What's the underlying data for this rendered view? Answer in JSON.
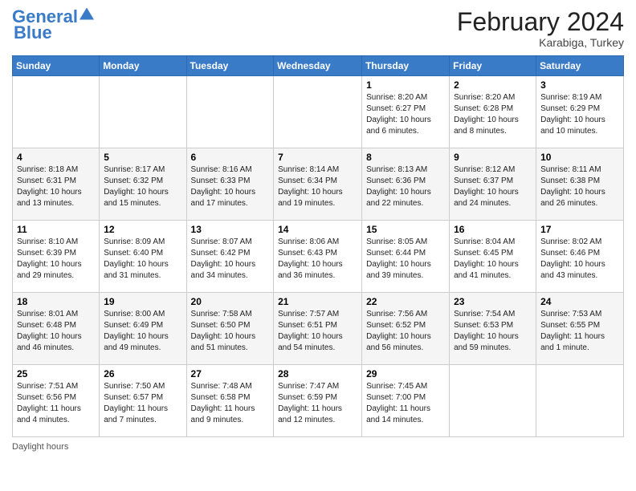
{
  "header": {
    "logo_line1": "General",
    "logo_line2": "Blue",
    "month_title": "February 2024",
    "location": "Karabiga, Turkey"
  },
  "footer": {
    "note": "Daylight hours"
  },
  "days_of_week": [
    "Sunday",
    "Monday",
    "Tuesday",
    "Wednesday",
    "Thursday",
    "Friday",
    "Saturday"
  ],
  "weeks": [
    [
      {
        "day": "",
        "info": ""
      },
      {
        "day": "",
        "info": ""
      },
      {
        "day": "",
        "info": ""
      },
      {
        "day": "",
        "info": ""
      },
      {
        "day": "1",
        "info": "Sunrise: 8:20 AM\nSunset: 6:27 PM\nDaylight: 10 hours\nand 6 minutes."
      },
      {
        "day": "2",
        "info": "Sunrise: 8:20 AM\nSunset: 6:28 PM\nDaylight: 10 hours\nand 8 minutes."
      },
      {
        "day": "3",
        "info": "Sunrise: 8:19 AM\nSunset: 6:29 PM\nDaylight: 10 hours\nand 10 minutes."
      }
    ],
    [
      {
        "day": "4",
        "info": "Sunrise: 8:18 AM\nSunset: 6:31 PM\nDaylight: 10 hours\nand 13 minutes."
      },
      {
        "day": "5",
        "info": "Sunrise: 8:17 AM\nSunset: 6:32 PM\nDaylight: 10 hours\nand 15 minutes."
      },
      {
        "day": "6",
        "info": "Sunrise: 8:16 AM\nSunset: 6:33 PM\nDaylight: 10 hours\nand 17 minutes."
      },
      {
        "day": "7",
        "info": "Sunrise: 8:14 AM\nSunset: 6:34 PM\nDaylight: 10 hours\nand 19 minutes."
      },
      {
        "day": "8",
        "info": "Sunrise: 8:13 AM\nSunset: 6:36 PM\nDaylight: 10 hours\nand 22 minutes."
      },
      {
        "day": "9",
        "info": "Sunrise: 8:12 AM\nSunset: 6:37 PM\nDaylight: 10 hours\nand 24 minutes."
      },
      {
        "day": "10",
        "info": "Sunrise: 8:11 AM\nSunset: 6:38 PM\nDaylight: 10 hours\nand 26 minutes."
      }
    ],
    [
      {
        "day": "11",
        "info": "Sunrise: 8:10 AM\nSunset: 6:39 PM\nDaylight: 10 hours\nand 29 minutes."
      },
      {
        "day": "12",
        "info": "Sunrise: 8:09 AM\nSunset: 6:40 PM\nDaylight: 10 hours\nand 31 minutes."
      },
      {
        "day": "13",
        "info": "Sunrise: 8:07 AM\nSunset: 6:42 PM\nDaylight: 10 hours\nand 34 minutes."
      },
      {
        "day": "14",
        "info": "Sunrise: 8:06 AM\nSunset: 6:43 PM\nDaylight: 10 hours\nand 36 minutes."
      },
      {
        "day": "15",
        "info": "Sunrise: 8:05 AM\nSunset: 6:44 PM\nDaylight: 10 hours\nand 39 minutes."
      },
      {
        "day": "16",
        "info": "Sunrise: 8:04 AM\nSunset: 6:45 PM\nDaylight: 10 hours\nand 41 minutes."
      },
      {
        "day": "17",
        "info": "Sunrise: 8:02 AM\nSunset: 6:46 PM\nDaylight: 10 hours\nand 43 minutes."
      }
    ],
    [
      {
        "day": "18",
        "info": "Sunrise: 8:01 AM\nSunset: 6:48 PM\nDaylight: 10 hours\nand 46 minutes."
      },
      {
        "day": "19",
        "info": "Sunrise: 8:00 AM\nSunset: 6:49 PM\nDaylight: 10 hours\nand 49 minutes."
      },
      {
        "day": "20",
        "info": "Sunrise: 7:58 AM\nSunset: 6:50 PM\nDaylight: 10 hours\nand 51 minutes."
      },
      {
        "day": "21",
        "info": "Sunrise: 7:57 AM\nSunset: 6:51 PM\nDaylight: 10 hours\nand 54 minutes."
      },
      {
        "day": "22",
        "info": "Sunrise: 7:56 AM\nSunset: 6:52 PM\nDaylight: 10 hours\nand 56 minutes."
      },
      {
        "day": "23",
        "info": "Sunrise: 7:54 AM\nSunset: 6:53 PM\nDaylight: 10 hours\nand 59 minutes."
      },
      {
        "day": "24",
        "info": "Sunrise: 7:53 AM\nSunset: 6:55 PM\nDaylight: 11 hours\nand 1 minute."
      }
    ],
    [
      {
        "day": "25",
        "info": "Sunrise: 7:51 AM\nSunset: 6:56 PM\nDaylight: 11 hours\nand 4 minutes."
      },
      {
        "day": "26",
        "info": "Sunrise: 7:50 AM\nSunset: 6:57 PM\nDaylight: 11 hours\nand 7 minutes."
      },
      {
        "day": "27",
        "info": "Sunrise: 7:48 AM\nSunset: 6:58 PM\nDaylight: 11 hours\nand 9 minutes."
      },
      {
        "day": "28",
        "info": "Sunrise: 7:47 AM\nSunset: 6:59 PM\nDaylight: 11 hours\nand 12 minutes."
      },
      {
        "day": "29",
        "info": "Sunrise: 7:45 AM\nSunset: 7:00 PM\nDaylight: 11 hours\nand 14 minutes."
      },
      {
        "day": "",
        "info": ""
      },
      {
        "day": "",
        "info": ""
      }
    ]
  ]
}
